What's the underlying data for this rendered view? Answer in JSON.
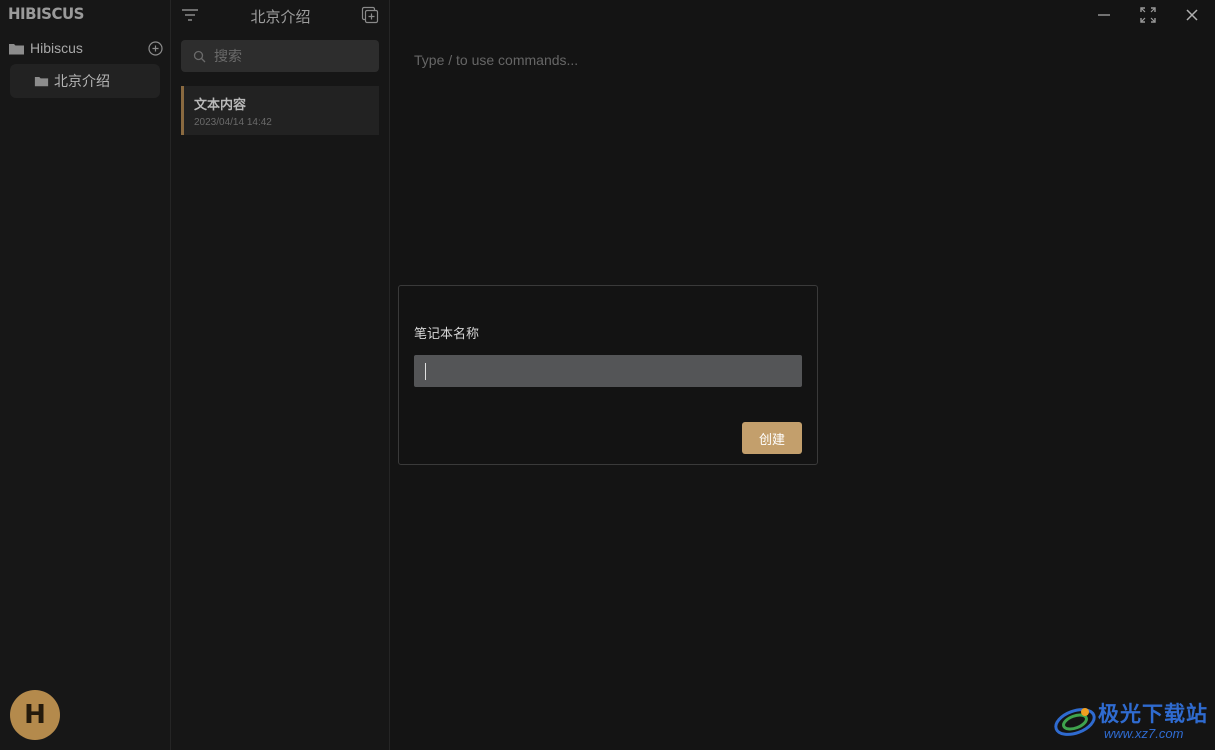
{
  "sidebar": {
    "logo": "HIBISCUS",
    "root_notebook": "Hibiscus",
    "notebooks": [
      {
        "label": "北京介绍"
      }
    ],
    "avatar_letter": "H"
  },
  "notelist": {
    "title": "北京介绍",
    "search_placeholder": "搜索",
    "notes": [
      {
        "title": "文本内容",
        "date": "2023/04/14 14:42"
      }
    ]
  },
  "editor": {
    "placeholder": "Type / to use commands..."
  },
  "dialog": {
    "label": "笔记本名称",
    "input_value": "",
    "create_label": "创建"
  },
  "watermark": {
    "text": "极光下载站",
    "url": "www.xz7.com"
  },
  "colors": {
    "accent": "#c39f6c",
    "avatar_bg": "#b48a4c",
    "background": "#141414",
    "note_marker": "#8a6a40"
  }
}
